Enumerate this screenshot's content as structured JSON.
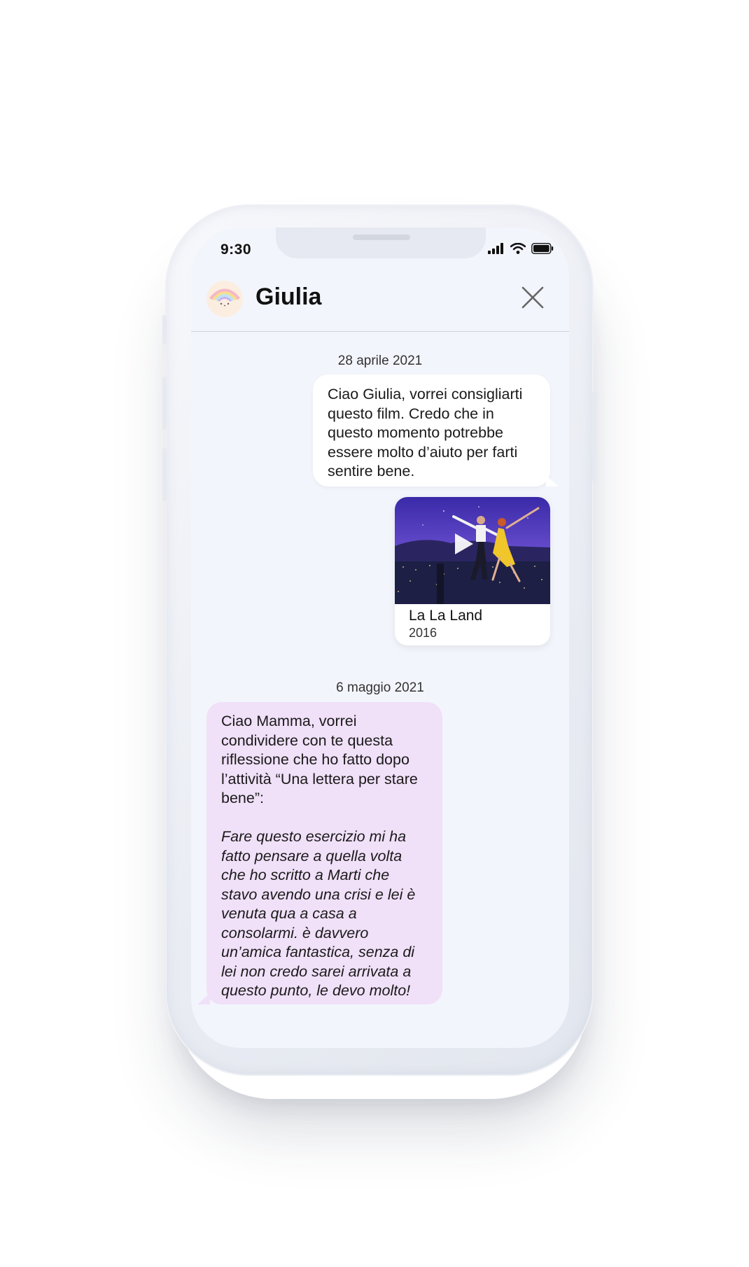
{
  "status_bar": {
    "time": "9:30",
    "icons": [
      "signal-icon",
      "wifi-icon",
      "battery-icon"
    ]
  },
  "header": {
    "contact_name": "Giulia",
    "close_icon": "close-icon",
    "avatar_icon": "avatar"
  },
  "messages": {
    "date1": "28 aprile 2021",
    "msg1_lines": [
      "Ciao Giulia, vorrei consigliarti",
      "questo film. Credo che in",
      "questo momento potrebbe",
      "essere molto d’aiuto per farti",
      "sentire bene."
    ],
    "movie": {
      "title": "La La Land",
      "year": "2016",
      "play_icon": "play-icon"
    },
    "date2": "6 maggio 2021",
    "msg2_lines": [
      "Ciao Mamma, vorrei",
      "condividere con te questa",
      "riflessione che ho fatto dopo",
      "l’attività “Una lettera per stare",
      "bene”:"
    ],
    "msg2_italic_lines": [
      "Fare questo esercizio mi ha",
      "fatto pensare a quella volta",
      "che ho scritto a Marti che",
      "stavo avendo una crisi e lei è",
      "venuta qua a casa a",
      "consolarmi. è davvero",
      "un’amica fantastica, senza di",
      "lei non credo sarei arrivata a",
      "questo punto, le devo molto!"
    ]
  },
  "colors": {
    "screen_bg": "#f3f5fc",
    "outgoing_bubble": "#ffffff",
    "incoming_bubble": "#f0e0f8",
    "phone_frame": "#eef0f5"
  }
}
